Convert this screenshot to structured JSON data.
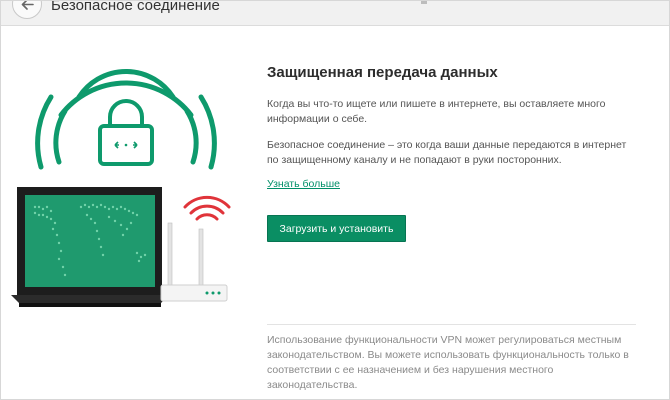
{
  "window": {
    "title": "Безопасное соединение"
  },
  "main": {
    "heading": "Защищенная передача данных",
    "paragraph1": "Когда вы что-то ищете или пишете в интернете, вы оставляете много информации о себе.",
    "paragraph2": "Безопасное соединение – это когда ваши данные передаются в интернет по защищенному каналу и не попадают в руки посторонних.",
    "learn_more_link": "Узнать больше",
    "install_button": "Загрузить и установить"
  },
  "footer": {
    "disclaimer": "Использование функциональности VPN может регулироваться местным законодательством. Вы можете использовать функциональность только в соответствии с ее назначением и без нарушения местного законодательства."
  },
  "icons": {
    "back": "arrow-left-icon",
    "lock": "lock-icon",
    "wifi_waves": "wifi-icon",
    "laptop": "laptop-icon",
    "router": "router-icon"
  },
  "colors": {
    "accent_green": "#0a8e63",
    "signal_red": "#e0343a",
    "screen_green": "#1f9a6e"
  }
}
